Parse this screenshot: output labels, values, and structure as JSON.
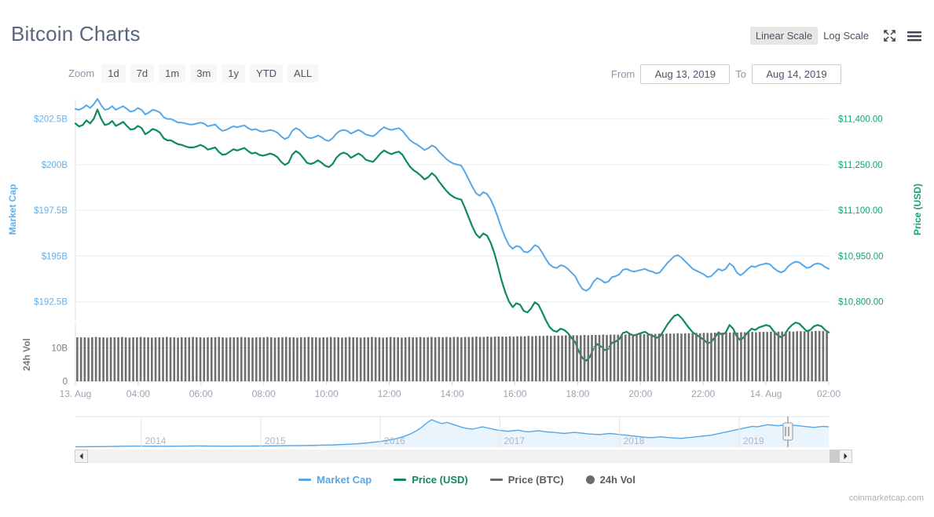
{
  "header": {
    "title": "Bitcoin Charts",
    "linear_scale_label": "Linear Scale",
    "log_scale_label": "Log Scale",
    "active_scale": "Linear Scale",
    "fullscreen_icon": "fullscreen-icon",
    "menu_icon": "hamburger-menu-icon"
  },
  "toolbar": {
    "zoom_label": "Zoom",
    "zoom_buttons": [
      "1d",
      "7d",
      "1m",
      "3m",
      "1y",
      "YTD",
      "ALL"
    ],
    "from_label": "From",
    "from_value": "Aug 13, 2019",
    "to_label": "To",
    "to_value": "Aug 14, 2019"
  },
  "legend": [
    {
      "label": "Market Cap",
      "color": "#56a7e8",
      "marker": "line"
    },
    {
      "label": "Price (USD)",
      "color": "#0e8a5f",
      "marker": "line"
    },
    {
      "label": "Price (BTC)",
      "color": "#6b6b6b",
      "marker": "line"
    },
    {
      "label": "24h Vol",
      "color": "#6b6b6b",
      "marker": "dot"
    }
  ],
  "footer": {
    "credit": "coinmarketcap.com"
  },
  "scrollbar": {
    "left_arrow_icon": "arrow-left-icon",
    "right_arrow_icon": "arrow-right-icon"
  },
  "chart_data": {
    "type": "line",
    "title": "Bitcoin Charts",
    "xlabel": "",
    "grid": true,
    "legend_position": "bottom",
    "axes": {
      "left": {
        "title": "Market Cap",
        "color": "#56a7e8",
        "ticks": [
          "$192.5B",
          "$195B",
          "$197.5B",
          "$200B",
          "$202.5B"
        ],
        "tick_values": [
          192.5,
          195,
          197.5,
          200,
          202.5
        ],
        "unit": "B USD",
        "ylim": [
          191.5,
          203.6
        ]
      },
      "right": {
        "title": "Price (USD)",
        "color": "#0e8a5f",
        "ticks": [
          "$10,800.00",
          "$10,950.00",
          "$11,100.00",
          "$11,250.00",
          "$11,400.00"
        ],
        "tick_values": [
          10800,
          10950,
          11100,
          11250,
          11400
        ],
        "unit": "USD",
        "ylim": [
          10740,
          11460
        ]
      },
      "volume": {
        "title": "24h Vol",
        "ticks": [
          "0",
          "10B"
        ],
        "tick_values": [
          0,
          10
        ],
        "ylim": [
          0,
          16
        ]
      }
    },
    "x_ticks": [
      "13. Aug",
      "04:00",
      "06:00",
      "08:00",
      "10:00",
      "12:00",
      "14:00",
      "16:00",
      "18:00",
      "20:00",
      "22:00",
      "14. Aug",
      "02:00"
    ],
    "series": [
      {
        "name": "Market Cap",
        "color": "#56a7e8",
        "axis": "left",
        "unit": "B USD",
        "values": [
          203.05,
          203.0,
          203.1,
          203.25,
          203.1,
          203.3,
          203.6,
          203.25,
          203.0,
          203.05,
          203.2,
          203.0,
          203.1,
          203.2,
          203.05,
          202.9,
          202.95,
          203.1,
          203.0,
          202.75,
          202.85,
          203.0,
          202.95,
          202.85,
          202.6,
          202.5,
          202.5,
          202.4,
          202.3,
          202.3,
          202.25,
          202.2,
          202.2,
          202.25,
          202.3,
          202.25,
          202.1,
          202.15,
          202.2,
          202.0,
          201.85,
          201.9,
          202.0,
          202.1,
          202.05,
          202.1,
          202.15,
          202.0,
          201.9,
          201.95,
          201.85,
          201.8,
          201.85,
          201.9,
          201.85,
          201.75,
          201.55,
          201.4,
          201.5,
          201.85,
          202.0,
          201.9,
          201.7,
          201.5,
          201.45,
          201.5,
          201.6,
          201.5,
          201.35,
          201.3,
          201.45,
          201.7,
          201.85,
          201.9,
          201.85,
          201.7,
          201.8,
          201.9,
          201.8,
          201.65,
          201.6,
          201.55,
          201.7,
          201.9,
          202.05,
          201.95,
          201.9,
          201.95,
          202.0,
          201.85,
          201.6,
          201.35,
          201.2,
          201.1,
          200.95,
          200.8,
          200.9,
          201.05,
          200.95,
          200.7,
          200.5,
          200.3,
          200.15,
          200.05,
          200.0,
          199.95,
          199.6,
          199.2,
          198.8,
          198.45,
          198.3,
          198.5,
          198.4,
          198.1,
          197.65,
          197.1,
          196.5,
          196.0,
          195.6,
          195.4,
          195.55,
          195.5,
          195.25,
          195.2,
          195.35,
          195.6,
          195.5,
          195.2,
          194.85,
          194.55,
          194.4,
          194.35,
          194.5,
          194.45,
          194.3,
          194.1,
          193.9,
          193.5,
          193.2,
          193.1,
          193.25,
          193.6,
          193.8,
          193.7,
          193.55,
          193.6,
          193.85,
          193.9,
          194.0,
          194.25,
          194.3,
          194.2,
          194.15,
          194.2,
          194.25,
          194.3,
          194.2,
          194.15,
          194.05,
          194.1,
          194.35,
          194.6,
          194.8,
          195.0,
          195.05,
          194.9,
          194.7,
          194.5,
          194.3,
          194.2,
          194.1,
          194.0,
          193.85,
          193.9,
          194.1,
          194.3,
          194.2,
          194.3,
          194.6,
          194.45,
          194.1,
          193.95,
          194.1,
          194.3,
          194.45,
          194.4,
          194.5,
          194.55,
          194.6,
          194.55,
          194.35,
          194.2,
          194.1,
          194.2,
          194.45,
          194.6,
          194.7,
          194.65,
          194.5,
          194.35,
          194.4,
          194.55,
          194.6,
          194.55,
          194.4,
          194.3
        ]
      },
      {
        "name": "Price (USD)",
        "color": "#0e8a5f",
        "axis": "right",
        "unit": "USD",
        "values": [
          11380,
          11370,
          11375,
          11390,
          11380,
          11395,
          11425,
          11395,
          11375,
          11378,
          11388,
          11372,
          11378,
          11385,
          11372,
          11360,
          11362,
          11372,
          11365,
          11345,
          11352,
          11362,
          11358,
          11350,
          11332,
          11325,
          11325,
          11318,
          11312,
          11310,
          11305,
          11302,
          11302,
          11305,
          11310,
          11305,
          11295,
          11298,
          11302,
          11288,
          11278,
          11280,
          11288,
          11296,
          11292,
          11296,
          11300,
          11290,
          11282,
          11285,
          11278,
          11275,
          11278,
          11282,
          11278,
          11270,
          11255,
          11245,
          11252,
          11278,
          11290,
          11282,
          11268,
          11252,
          11248,
          11252,
          11260,
          11252,
          11242,
          11238,
          11248,
          11268,
          11280,
          11285,
          11280,
          11268,
          11275,
          11282,
          11275,
          11262,
          11258,
          11255,
          11268,
          11282,
          11292,
          11285,
          11280,
          11285,
          11288,
          11278,
          11258,
          11240,
          11228,
          11220,
          11210,
          11198,
          11205,
          11218,
          11208,
          11190,
          11175,
          11160,
          11148,
          11140,
          11135,
          11132,
          11105,
          11075,
          11045,
          11020,
          11008,
          11022,
          11015,
          10992,
          10958,
          10915,
          10868,
          10830,
          10800,
          10782,
          10795,
          10790,
          10770,
          10765,
          10778,
          10798,
          10790,
          10766,
          10740,
          10718,
          10706,
          10702,
          10712,
          10708,
          10698,
          10682,
          10668,
          10638,
          10616,
          10608,
          10620,
          10648,
          10662,
          10654,
          10642,
          10646,
          10666,
          10670,
          10678,
          10698,
          10702,
          10694,
          10690,
          10694,
          10698,
          10702,
          10694,
          10690,
          10682,
          10686,
          10704,
          10724,
          10740,
          10754,
          10758,
          10746,
          10730,
          10714,
          10700,
          10692,
          10684,
          10676,
          10665,
          10668,
          10684,
          10700,
          10692,
          10700,
          10724,
          10712,
          10686,
          10674,
          10686,
          10700,
          10712,
          10708,
          10716,
          10720,
          10724,
          10720,
          10704,
          10692,
          10684,
          10692,
          10712,
          10724,
          10732,
          10728,
          10716,
          10704,
          10708,
          10720,
          10724,
          10720,
          10708,
          10700
        ]
      },
      {
        "name": "24h Vol",
        "color": "#6b6b6b",
        "axis": "volume",
        "unit": "B USD",
        "values": [
          13.2,
          13.2,
          13.2,
          13.1,
          13.2,
          13.3,
          13.2,
          13.2,
          13.1,
          13.2,
          13.2,
          13.2,
          13.3,
          13.2,
          13.1,
          13.2,
          13.2,
          13.3,
          13.2,
          13.2,
          13.1,
          13.2,
          13.2,
          13.2,
          13.3,
          13.2,
          13.2,
          13.1,
          13.2,
          13.2,
          13.2,
          13.3,
          13.2,
          13.2,
          13.1,
          13.2,
          13.2,
          13.2,
          13.3,
          13.2,
          13.1,
          13.2,
          13.2,
          13.2,
          13.3,
          13.2,
          13.2,
          13.1,
          13.2,
          13.2,
          13.2,
          13.3,
          13.2,
          13.1,
          13.2,
          13.2,
          13.3,
          13.2,
          13.2,
          13.1,
          13.2,
          13.2,
          13.3,
          13.2,
          13.2,
          13.1,
          13.2,
          13.2,
          13.3,
          13.2,
          13.2,
          13.1,
          13.2,
          13.3,
          13.2,
          13.2,
          13.1,
          13.2,
          13.2,
          13.3,
          13.2,
          13.2,
          13.1,
          13.2,
          13.3,
          13.2,
          13.2,
          13.1,
          13.2,
          13.3,
          13.2,
          13.2,
          13.3,
          13.2,
          13.2,
          13.3,
          13.2,
          13.3,
          13.2,
          13.3,
          13.2,
          13.3,
          13.3,
          13.2,
          13.3,
          13.3,
          13.3,
          13.4,
          13.3,
          13.3,
          13.4,
          13.3,
          13.4,
          13.4,
          13.4,
          13.4,
          13.5,
          13.4,
          13.5,
          13.5,
          13.5,
          13.6,
          13.5,
          13.6,
          13.6,
          13.6,
          13.7,
          13.6,
          13.7,
          13.7,
          13.7,
          13.8,
          13.7,
          13.8,
          13.8,
          13.8,
          13.9,
          13.8,
          13.9,
          13.9,
          13.9,
          14.0,
          13.9,
          14.0,
          14.0,
          14.0,
          14.1,
          14.0,
          14.1,
          14.1,
          14.1,
          14.2,
          14.1,
          14.2,
          14.2,
          14.2,
          14.3,
          14.2,
          14.3,
          14.3,
          14.3,
          14.4,
          14.3,
          14.4,
          14.4,
          14.4,
          14.5,
          14.4,
          14.5,
          14.5,
          14.5,
          14.6,
          14.5,
          14.6,
          14.6,
          14.6,
          14.7,
          14.6,
          14.7,
          14.7,
          14.7,
          14.8,
          14.7,
          14.8,
          14.8,
          14.8,
          14.9,
          14.8,
          14.9,
          14.9,
          14.9,
          15.0,
          14.9,
          15.0,
          15.0,
          15.0,
          15.1,
          15.0,
          15.1,
          15.1,
          15.1,
          15.2
        ]
      }
    ],
    "navigator": {
      "year_ticks": [
        "2014",
        "2015",
        "2016",
        "2017",
        "2018",
        "2019"
      ],
      "series_name": "Market Cap",
      "color": "#56a7e8",
      "values": [
        1.5,
        1.6,
        1.7,
        1.8,
        2.0,
        2.2,
        2.4,
        2.6,
        3.0,
        3.4,
        3.8,
        4.0,
        4.2,
        4.0,
        3.8,
        3.6,
        3.4,
        3.4,
        3.5,
        3.6,
        3.8,
        4.0,
        4.2,
        4.4,
        4.6,
        4.4,
        4.2,
        4.0,
        3.9,
        3.8,
        3.8,
        3.9,
        4.0,
        4.1,
        4.2,
        4.3,
        4.4,
        4.6,
        4.8,
        5.0,
        5.2,
        5.4,
        5.6,
        5.8,
        6.0,
        6.2,
        6.4,
        6.8,
        7.2,
        7.6,
        8.0,
        8.6,
        9.4,
        10.2,
        11.0,
        12.0,
        13.5,
        15.0,
        17.0,
        19.0,
        21.0,
        24.0,
        27.0,
        31.0,
        36.0,
        42.0,
        50.0,
        60.0,
        72.0,
        88.0,
        100.0,
        92.0,
        86.0,
        90.0,
        84.0,
        78.0,
        72.0,
        68.0,
        66.0,
        70.0,
        74.0,
        70.0,
        66.0,
        62.0,
        60.0,
        58.0,
        60.0,
        62.0,
        58.0,
        56.0,
        58.0,
        60.0,
        57.0,
        55.0,
        54.0,
        52.0,
        50.0,
        52.0,
        54.0,
        52.0,
        50.0,
        48.0,
        47.0,
        46.0,
        48.0,
        50.0,
        48.0,
        46.0,
        44.0,
        42.0,
        40.0,
        38.0,
        36.0,
        35.0,
        36.0,
        38.0,
        36.0,
        34.0,
        33.0,
        32.0,
        34.0,
        36.0,
        38.0,
        40.0,
        42.0,
        44.0,
        48.0,
        52.0,
        56.0,
        60.0,
        64.0,
        68.0,
        72.0,
        76.0,
        74.0,
        78.0,
        82.0,
        80.0,
        78.0,
        80.0,
        82.0,
        80.0,
        78.0,
        76.0,
        74.0,
        72.0,
        74.0,
        76.0,
        74.0
      ]
    }
  }
}
